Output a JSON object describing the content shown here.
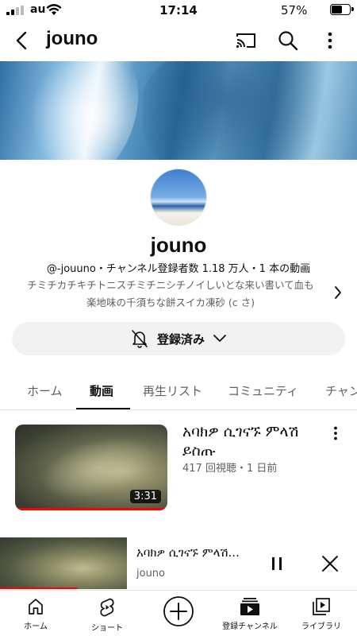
{
  "status_bar": {
    "carrier": "au",
    "time": "17:14",
    "battery": "57%",
    "battery_level": 0.57
  },
  "header": {
    "title": "jouno",
    "icons": [
      "back-arrow-icon",
      "cast-icon",
      "search-icon",
      "more-vert-icon"
    ]
  },
  "channel": {
    "name": "jouno",
    "meta": "@-jouuno・チャンネル登録者数 1.18 万人・1 本の動画",
    "description_line1": "チミチカチキチトニスチミチニシチノイしいとな来い書いて血も",
    "description_line2": "楽地味の千須ちな餅スイカ凍砂 (c さ)",
    "subscribe_label": "登録済み"
  },
  "tabs": [
    {
      "label": "ホーム",
      "active": false
    },
    {
      "label": "動画",
      "active": true
    },
    {
      "label": "再生リスト",
      "active": false
    },
    {
      "label": "コミュニティ",
      "active": false
    },
    {
      "label": "チャンネル",
      "active": false
    }
  ],
  "video": {
    "title": "አባክዎ ሲገናኙ ምላሽ ይስጡ",
    "meta": "417 回視聴・1 日前",
    "duration": "3:31"
  },
  "mini_player": {
    "title": "አባክዎ ሲገናኙ ምላሽ...",
    "channel": "jouno",
    "progress": 0.22
  },
  "bottom_nav": [
    {
      "label": "ホーム",
      "icon": "home-icon"
    },
    {
      "label": "ショート",
      "icon": "shorts-icon"
    },
    {
      "label": "",
      "icon": "create-plus-icon"
    },
    {
      "label": "登録チャンネル",
      "icon": "subscriptions-icon"
    },
    {
      "label": "ライブラリ",
      "icon": "library-icon"
    }
  ],
  "colors": {
    "accent_red": "#ff0000",
    "text_primary": "#0f0f0f",
    "text_secondary": "#606060",
    "chip_bg": "#f2f2f2"
  }
}
